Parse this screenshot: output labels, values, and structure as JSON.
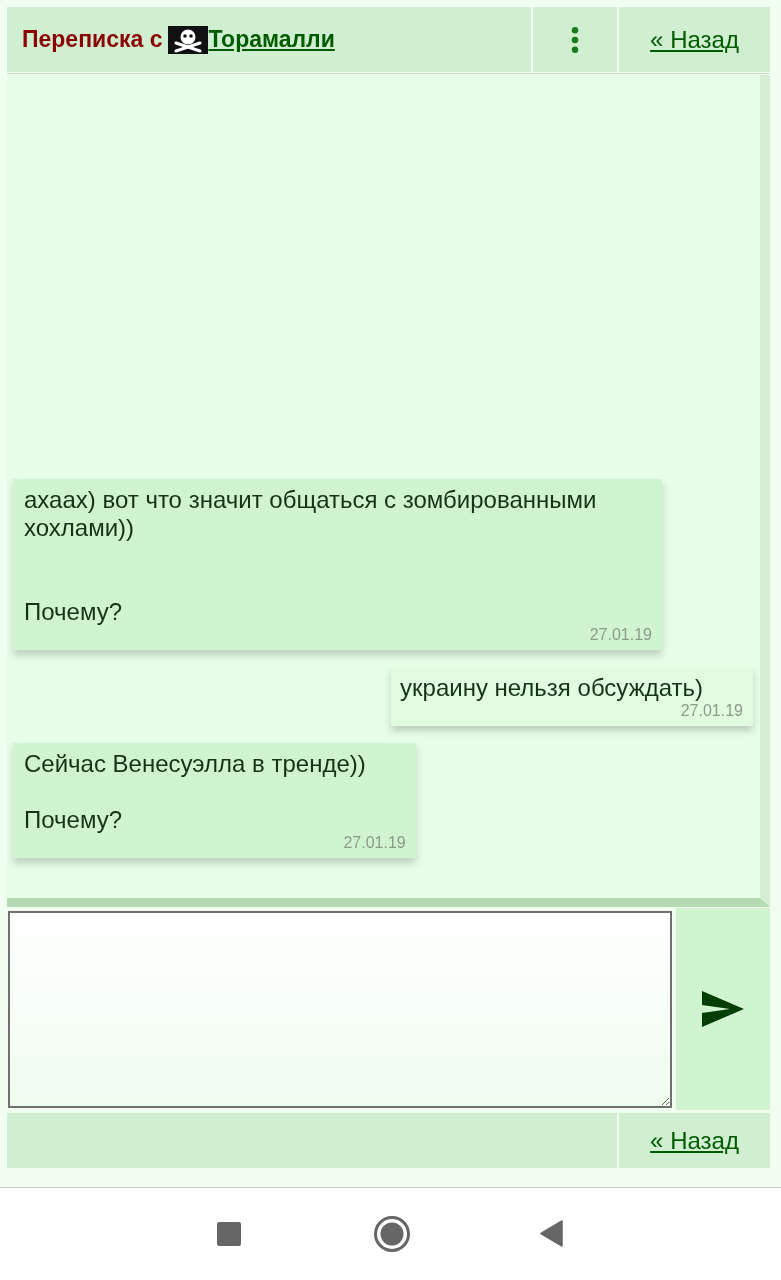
{
  "header": {
    "title": "Переписка с",
    "contact": "Торамалли",
    "back_link": "« Назад"
  },
  "messages": [
    {
      "kind": "received",
      "text": "ахаах) вот что значит общаться с зомбированными хохлами))\n\n\nПочему?",
      "date": "27.01.19"
    },
    {
      "kind": "sent",
      "text": "украину нельзя обсуждать)",
      "date": "27.01.19"
    },
    {
      "kind": "received",
      "text": "Сейчас Венесуэлла в тренде))\n\nПочему?",
      "date": "27.01.19"
    }
  ],
  "footer": {
    "back_link": "« Назад"
  }
}
